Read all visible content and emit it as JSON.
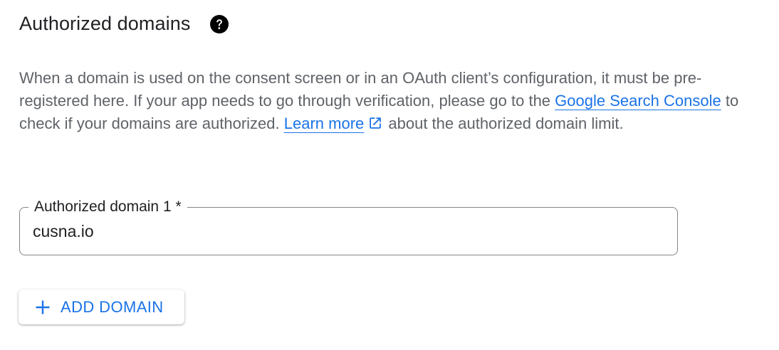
{
  "section": {
    "title": "Authorized domains",
    "help_icon": "help-circle-icon"
  },
  "description": {
    "text_before_link": "When a domain is used on the consent screen or in an OAuth client’s configuration, it must be pre-registered here. If your app needs to go through verification, please go to the ",
    "search_console_link": "Google Search Console",
    "text_middle": " to check if your domains are authorized. ",
    "learn_more_link": "Learn more",
    "external_icon": "open-in-new-icon",
    "text_after": " about the authorized domain limit."
  },
  "domain_field": {
    "label": "Authorized domain 1 *",
    "value": "cusna.io"
  },
  "add_button": {
    "icon": "plus-icon",
    "label": "ADD DOMAIN"
  },
  "colors": {
    "link": "#1a73e8",
    "text": "#202124",
    "secondary_text": "#5f6368",
    "border": "#80868b"
  }
}
